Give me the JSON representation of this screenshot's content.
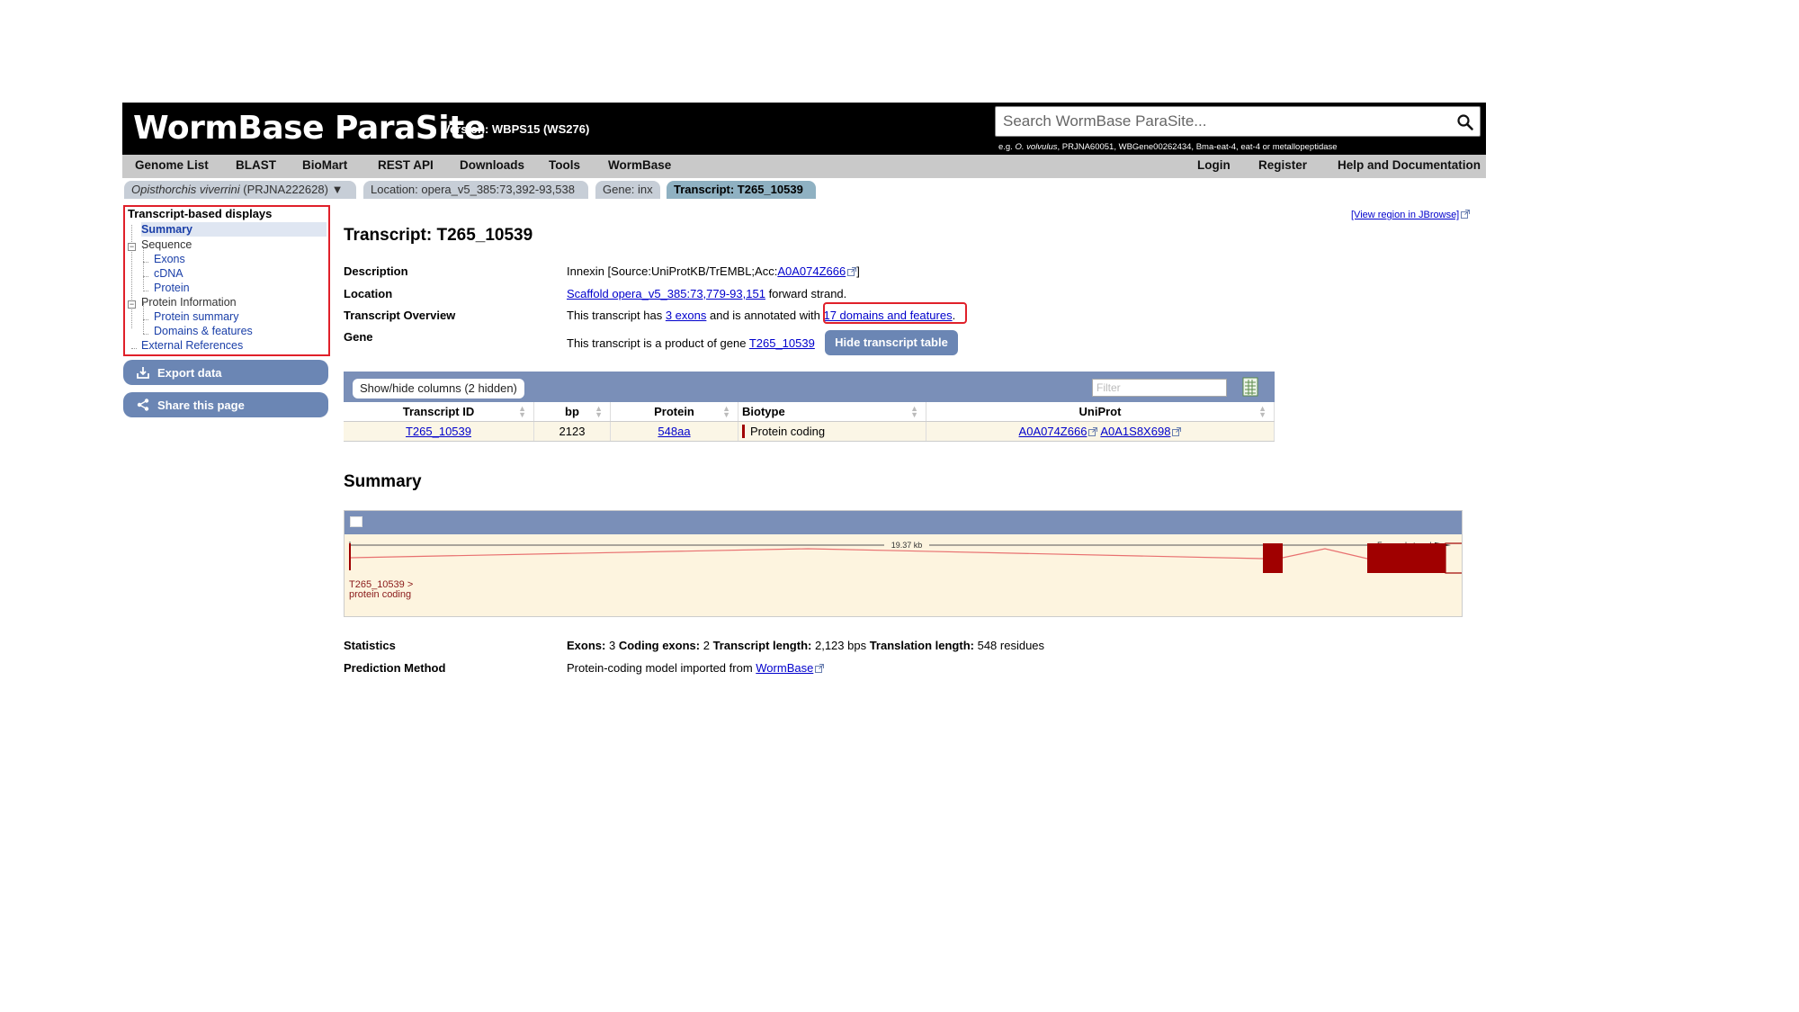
{
  "header": {
    "logo_text": "WormBase ParaSite",
    "version": "Version: WBPS15 (WS276)",
    "search_placeholder": "Search WormBase ParaSite...",
    "search_example_prefix": "e.g. ",
    "search_example_species": "O. volvulus",
    "search_example_rest": ", PRJNA60051, WBGene00262434, Bma-eat-4, eat-4 or metallopeptidase"
  },
  "nav": {
    "left": [
      "Genome List",
      "BLAST",
      "BioMart",
      "REST API",
      "Downloads",
      "Tools",
      "WormBase"
    ],
    "right": [
      "Login",
      "Register",
      "Help and Documentation"
    ]
  },
  "breadcrumbs": {
    "species": "Opisthorchis viverrini",
    "species_suffix": " (PRJNA222628)",
    "dropdown_arrow": "▼",
    "location": "Location: opera_v5_385:73,392-93,538",
    "gene": "Gene: inx",
    "transcript": "Transcript: T265_10539"
  },
  "sidebar": {
    "title": "Transcript-based displays",
    "items": {
      "summary": "Summary",
      "sequence": "Sequence",
      "exons": "Exons",
      "cdna": "cDNA",
      "protein": "Protein",
      "protein_information": "Protein Information",
      "protein_summary": "Protein summary",
      "domains_features": "Domains & features",
      "external_references": "External References"
    },
    "export_label": "Export data",
    "share_label": "Share this page"
  },
  "main": {
    "jbrowse_link": "[View region in JBrowse]",
    "title": "Transcript: T265_10539",
    "description_label": "Description",
    "description_text": "Innexin [Source:UniProtKB/TrEMBL;Acc:",
    "description_acc": "A0A074Z666",
    "description_end": "]",
    "location_label": "Location",
    "location_link": "Scaffold opera_v5_385:73,779-93,151",
    "location_rest": " forward strand.",
    "overview_label": "Transcript Overview",
    "overview_pre": "This transcript has ",
    "overview_exons": "3 exons",
    "overview_mid": " and is annotated with ",
    "overview_domains": "17 domains and features",
    "overview_end": ".",
    "gene_label": "Gene",
    "gene_pre": "This transcript is a product of gene ",
    "gene_link": "T265_10539",
    "hide_table_btn": "Hide transcript table"
  },
  "table": {
    "showhide": "Show/hide columns (2 hidden)",
    "filter_placeholder": "Filter",
    "columns": [
      "Transcript ID",
      "bp",
      "Protein",
      "Biotype",
      "UniProt"
    ],
    "row": {
      "transcript_id": "T265_10539",
      "bp": "2123",
      "protein": "548aa",
      "biotype": "Protein coding",
      "uniprot_1": "A0A074Z666",
      "uniprot_2": "A0A1S8X698"
    }
  },
  "summary": {
    "heading": "Summary",
    "scale_label": "19.37 kb",
    "strand_label": "Forward strand",
    "track_label_1": "T265_10539 >",
    "track_label_2": "protein coding",
    "statistics_label": "Statistics",
    "stats": {
      "exons_label": "Exons:",
      "exons_value": " 3 ",
      "coding_label": "Coding exons:",
      "coding_value": " 2 ",
      "length_label": "Transcript length:",
      "length_value": " 2,123 bps ",
      "translation_label": "Translation length:",
      "translation_value": " 548 residues"
    },
    "prediction_label": "Prediction Method",
    "prediction_text": "Protein-coding model imported from ",
    "prediction_link": "WormBase"
  },
  "colors": {
    "masthead": "#000000",
    "navbar": "#c9c9c9",
    "accent_button": "#6b86b4",
    "table_header": "#7a8fb8",
    "highlight_box": "#e0202a",
    "exon": "#a00000",
    "intron": "#e87070"
  }
}
